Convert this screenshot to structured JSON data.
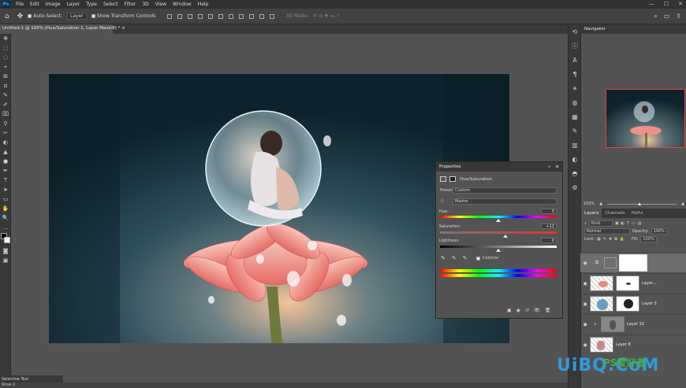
{
  "menubar": {
    "logo": "Ps",
    "menus": [
      "File",
      "Edit",
      "Image",
      "Layer",
      "Type",
      "Select",
      "Filter",
      "3D",
      "View",
      "Window",
      "Help"
    ],
    "window_controls": [
      "—",
      "☐",
      "✕"
    ]
  },
  "options": {
    "auto_select_label": "Auto-Select:",
    "auto_select_target": "Layer",
    "transform_controls_label": "Show Transform Controls",
    "mode_3d": "3D Mode:"
  },
  "document": {
    "tab_title": "Untitled-1 @ 100% (Hue/Saturation 1, Layer Mask/8) *",
    "tab_close": "×"
  },
  "tools": [
    "✥",
    "⬚",
    "◌",
    "⌖",
    "⊞",
    "⧄",
    "✎",
    "✐",
    "⌧",
    "⚲",
    "✂",
    "◐",
    "▲",
    "●",
    "✒",
    "T",
    "➤",
    "▭",
    "✋",
    "🔍",
    "…",
    "■"
  ],
  "navigator": {
    "title": "Navigator",
    "zoom": "100%"
  },
  "layers_panel": {
    "tabs": [
      "Layers",
      "Channels",
      "Paths"
    ],
    "kind_label": "Kind",
    "blend_mode": "Normal",
    "opacity_label": "Opacity:",
    "opacity_value": "100%",
    "lock_label": "Lock:",
    "fill_label": "Fill:",
    "fill_value": "100%",
    "layers": [
      {
        "name": "",
        "visible": true
      },
      {
        "name": "Layer...",
        "visible": true
      },
      {
        "name": "Layer 3",
        "visible": true
      },
      {
        "name": "Layer 10",
        "visible": true
      },
      {
        "name": "Layer 8",
        "visible": true
      }
    ]
  },
  "properties": {
    "tab": "Properties",
    "adjustment_name": "Hue/Saturation",
    "preset_label": "Preset:",
    "preset_value": "Custom",
    "channel_value": "Master",
    "hue_label": "Hue:",
    "hue_value": "0",
    "hue_fraction": 0.5,
    "saturation_label": "Saturation:",
    "saturation_value": "+12",
    "saturation_fraction": 0.56,
    "lightness_label": "Lightness:",
    "lightness_value": "0",
    "lightness_fraction": 0.5,
    "colorize_label": "Colorize"
  },
  "bottom": {
    "panel_label": "Selective Too!",
    "panel_sublabel": "Shoe 2"
  },
  "watermark": {
    "text": "UiBQ.CoM",
    "sub": "PS爱好者"
  },
  "colors": {
    "accent_border": "#ee4433",
    "foreground": "#000000",
    "background": "#ffffff"
  }
}
